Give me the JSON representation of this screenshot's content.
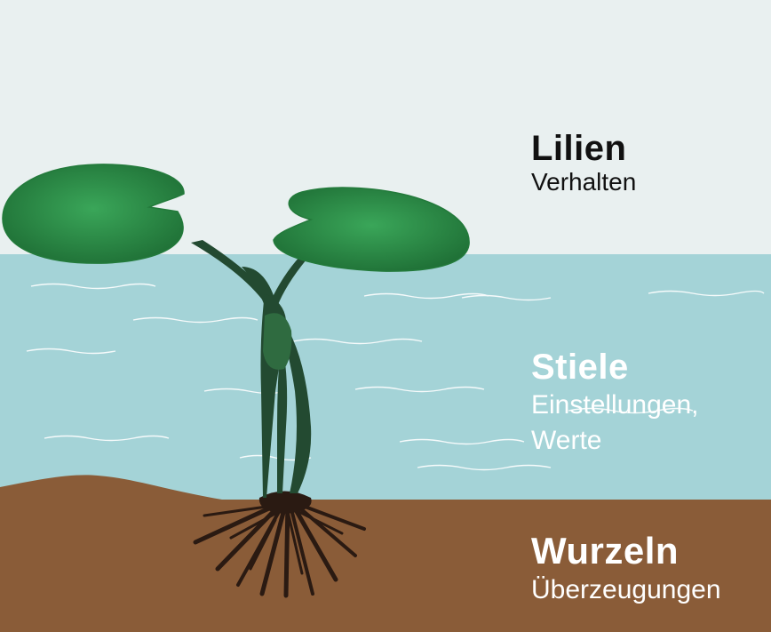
{
  "colors": {
    "sky": "#e9f0f0",
    "water": "#a4d3d7",
    "soil": "#8a5c38",
    "leaf": "#2e8f45",
    "stem": "#234a31",
    "roots": "#2a1a12"
  },
  "layers": [
    {
      "key": "lilien",
      "title": "Lilien",
      "subtitle_lines": [
        "Verhalten"
      ]
    },
    {
      "key": "stiele",
      "title": "Stiele",
      "subtitle_lines": [
        "Einstellungen,",
        "Werte"
      ]
    },
    {
      "key": "wurzeln",
      "title": "Wurzeln",
      "subtitle_lines": [
        "Überzeugungen"
      ]
    }
  ]
}
